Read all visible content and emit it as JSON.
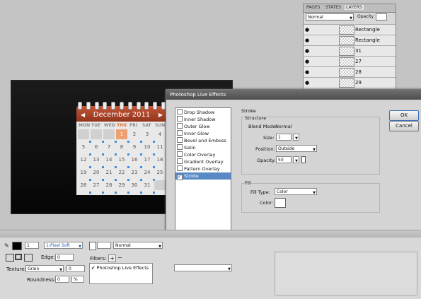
{
  "calendar": {
    "title": "December 2011",
    "weekdays": [
      "MON",
      "TUE",
      "WED",
      "THU",
      "FRI",
      "SAT",
      "SUN"
    ],
    "rows": [
      [
        "",
        "",
        "",
        "1",
        "2",
        "3",
        "4"
      ],
      [
        "5",
        "6",
        "7",
        "8",
        "9",
        "10",
        "11"
      ],
      [
        "12",
        "13",
        "14",
        "15",
        "16",
        "17",
        "18"
      ],
      [
        "19",
        "20",
        "21",
        "22",
        "23",
        "24",
        "25"
      ],
      [
        "26",
        "27",
        "28",
        "29",
        "30",
        "31",
        ""
      ]
    ],
    "highlight_day": "1",
    "header_color": "#b5442a",
    "highlight_color": "#f0a070",
    "selection_color": "#3f8fd8"
  },
  "layers_panel": {
    "tabs": [
      "PAGES",
      "STATES",
      "LAYERS"
    ],
    "active_tab": "LAYERS",
    "blend_mode": "Normal",
    "opacity_label": "Opacity",
    "layers": [
      "Rectangle",
      "Rectangle",
      "31",
      "27",
      "28",
      "29"
    ]
  },
  "dialog": {
    "title": "Photoshop Live Effects",
    "effects": [
      "Drop Shadow",
      "Inner Shadow",
      "Outer Glow",
      "Inner Glow",
      "Bevel and Emboss",
      "Satin",
      "Color Overlay",
      "Gradient Overlay",
      "Pattern Overlay",
      "Stroke"
    ],
    "checked_effects": [
      "Stroke"
    ],
    "selected_effect": "Stroke",
    "section_title": "Stroke",
    "structure_label": "Structure",
    "blend_mode_label": "Blend Mode:",
    "blend_mode_value": "Normal",
    "size_label": "Size:",
    "size_value": "1",
    "position_label": "Position:",
    "position_value": "Outside",
    "opacity_label": "Opacity:",
    "opacity_value": "50",
    "fill_label": "Fill",
    "fill_type_label": "Fill Type:",
    "fill_type_value": "Color",
    "color_label": "Color:",
    "ok_label": "OK",
    "cancel_label": "Cancel"
  },
  "properties": {
    "stroke_width": "1",
    "brush": "1-Pixel Soft",
    "edge_label": "Edge:",
    "edge_value": "0",
    "texture_label": "Texture:",
    "texture_value": "Grain",
    "texture_amount": "0",
    "roundness_label": "Roundness:",
    "roundness_value": "0",
    "roundness_unit": "%",
    "blend": "Normal",
    "filters_label": "Filters:",
    "live_effect_item": "Photoshop Live Effects"
  }
}
